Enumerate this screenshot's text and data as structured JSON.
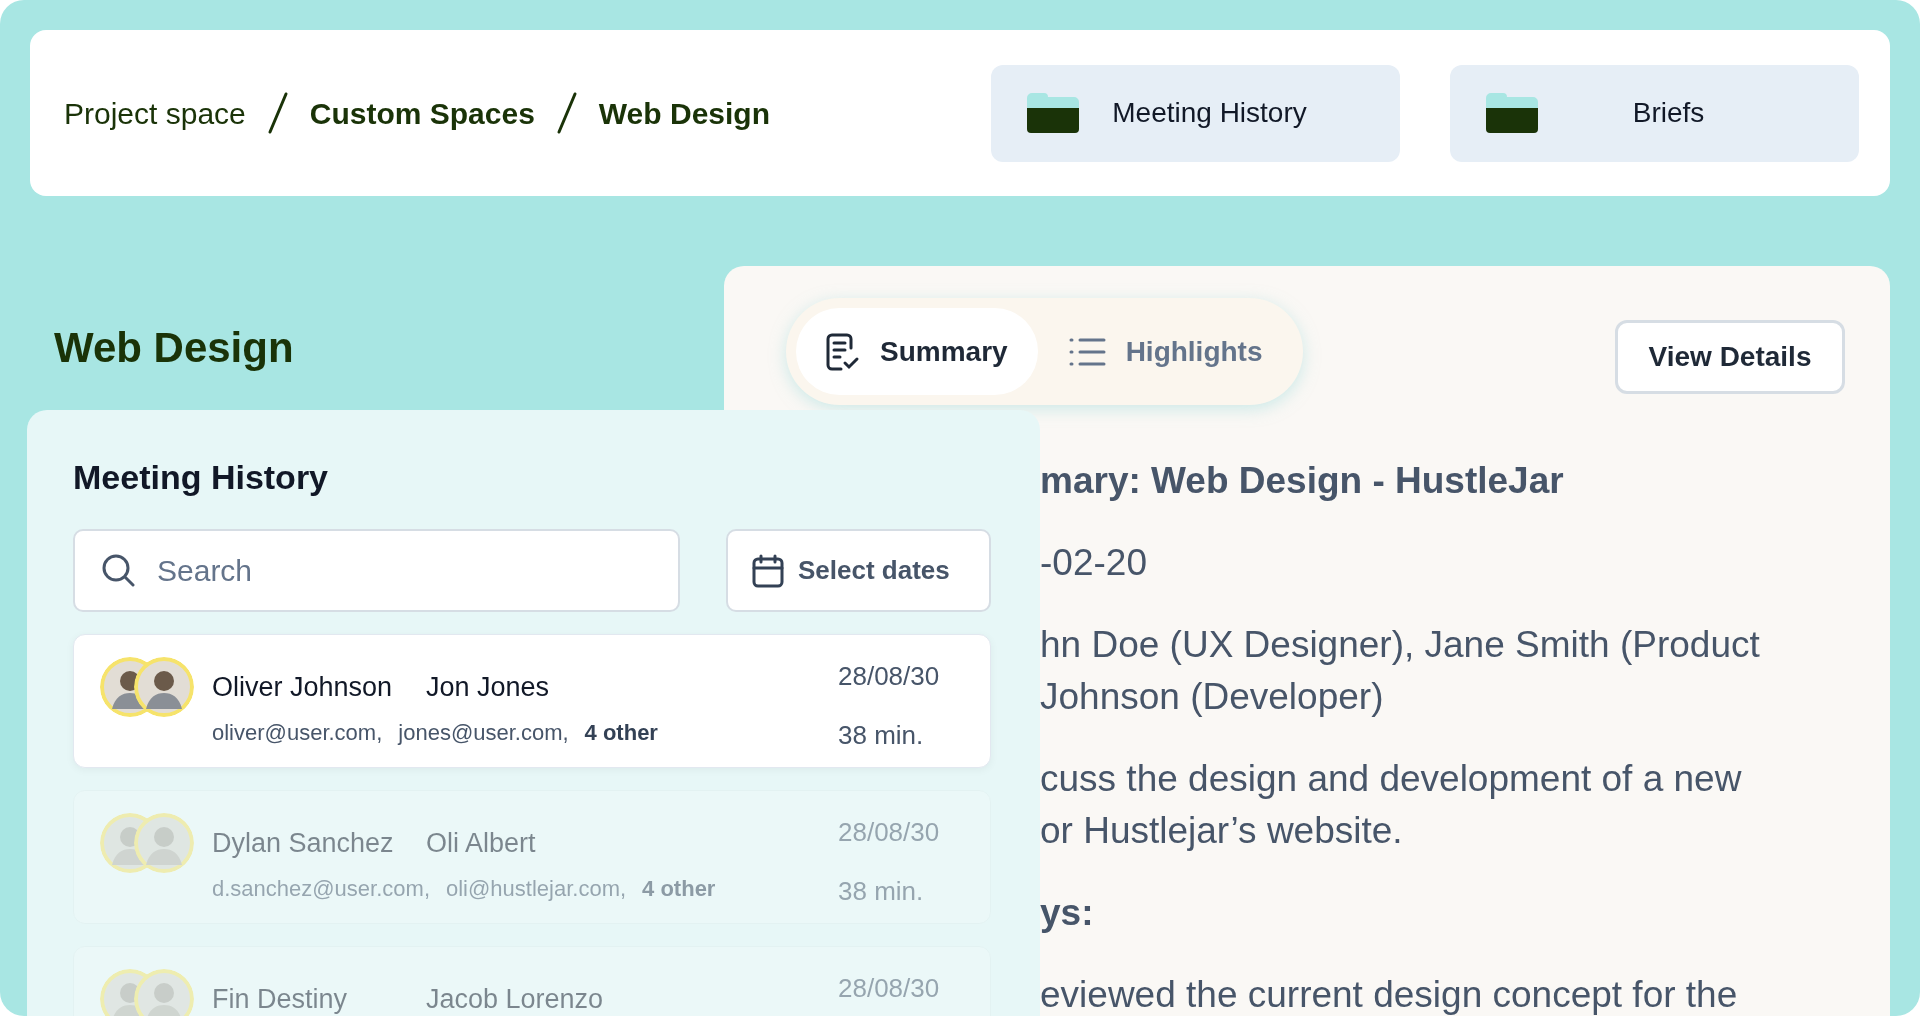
{
  "breadcrumb": [
    {
      "label": "Project space"
    },
    {
      "label": "Custom Spaces"
    },
    {
      "label": "Web Design"
    }
  ],
  "quick_links": [
    {
      "label": "Meeting History"
    },
    {
      "label": "Briefs"
    }
  ],
  "page_title": "Web Design",
  "summary_panel": {
    "tabs": [
      {
        "label": "Summary",
        "selected": true,
        "kind": "document"
      },
      {
        "label": "Highlights",
        "selected": false,
        "kind": "list"
      }
    ],
    "view_details": "View Details",
    "lines": [
      {
        "kind": "heading",
        "text": "mary: Web Design - HustleJar"
      },
      {
        "kind": "gap"
      },
      {
        "kind": "text",
        "text": "-02-20"
      },
      {
        "kind": "gap"
      },
      {
        "kind": "text",
        "text": "hn Doe (UX Designer), Jane Smith (Product"
      },
      {
        "kind": "text",
        "text": "Johnson (Developer)"
      },
      {
        "kind": "gap"
      },
      {
        "kind": "text",
        "text": "cuss the design and development of a new"
      },
      {
        "kind": "text",
        "text": "or Hustlejar’s website."
      },
      {
        "kind": "gap"
      },
      {
        "kind": "heading",
        "text": "ys:"
      },
      {
        "kind": "gap"
      },
      {
        "kind": "text",
        "text": "eviewed the current design concept for the"
      }
    ]
  },
  "history": {
    "title": "Meeting History",
    "search": {
      "placeholder": "Search"
    },
    "date_button": "Select dates",
    "meetings": [
      {
        "selected": true,
        "names": [
          "Oliver Johnson",
          "Jon Jones"
        ],
        "emails": [
          "oliver@user.com,",
          "jones@user.com,"
        ],
        "others": "4 other",
        "date": "28/08/30",
        "duration": "38 min."
      },
      {
        "selected": false,
        "names": [
          "Dylan Sanchez",
          "Oli Albert"
        ],
        "emails": [
          "d.sanchez@user.com,",
          "oli@hustlejar.com,"
        ],
        "others": "4 other",
        "date": "28/08/30",
        "duration": "38 min."
      },
      {
        "selected": false,
        "names": [
          "Fin Destiny",
          "Jacob Lorenzo"
        ],
        "date": "28/08/30"
      }
    ]
  }
}
